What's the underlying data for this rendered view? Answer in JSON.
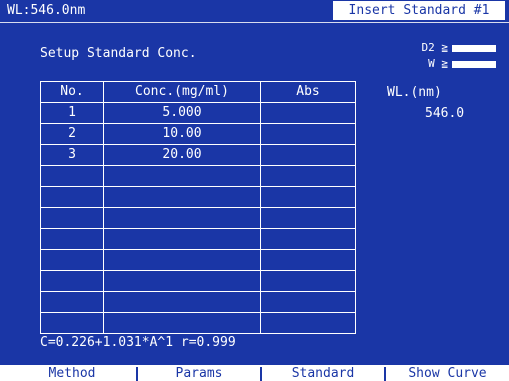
{
  "header": {
    "status": "WL:546.0nm",
    "mode_title": "Insert Standard #1"
  },
  "screen": {
    "subtitle": "Setup Standard Conc."
  },
  "lamps": [
    {
      "label": "D2 ≧"
    },
    {
      "label": "W ≧"
    }
  ],
  "wavelength": {
    "label": "WL.(nm)",
    "value": "546.0"
  },
  "table": {
    "headers": [
      "No.",
      "Conc.(mg/ml)",
      "Abs"
    ],
    "rows": [
      [
        "1",
        "5.000",
        ""
      ],
      [
        "2",
        "10.00",
        ""
      ],
      [
        "3",
        "20.00",
        ""
      ],
      [
        "",
        "",
        ""
      ],
      [
        "",
        "",
        ""
      ],
      [
        "",
        "",
        ""
      ],
      [
        "",
        "",
        ""
      ],
      [
        "",
        "",
        ""
      ],
      [
        "",
        "",
        ""
      ],
      [
        "",
        "",
        ""
      ],
      [
        "",
        "",
        ""
      ]
    ]
  },
  "equation": "C=0.226+1.031*A^1  r=0.999",
  "softkeys": [
    "Method",
    "Params",
    "Standard",
    "Show Curve"
  ],
  "colors": {
    "background": "#1a36a6",
    "foreground": "#ffffff"
  }
}
